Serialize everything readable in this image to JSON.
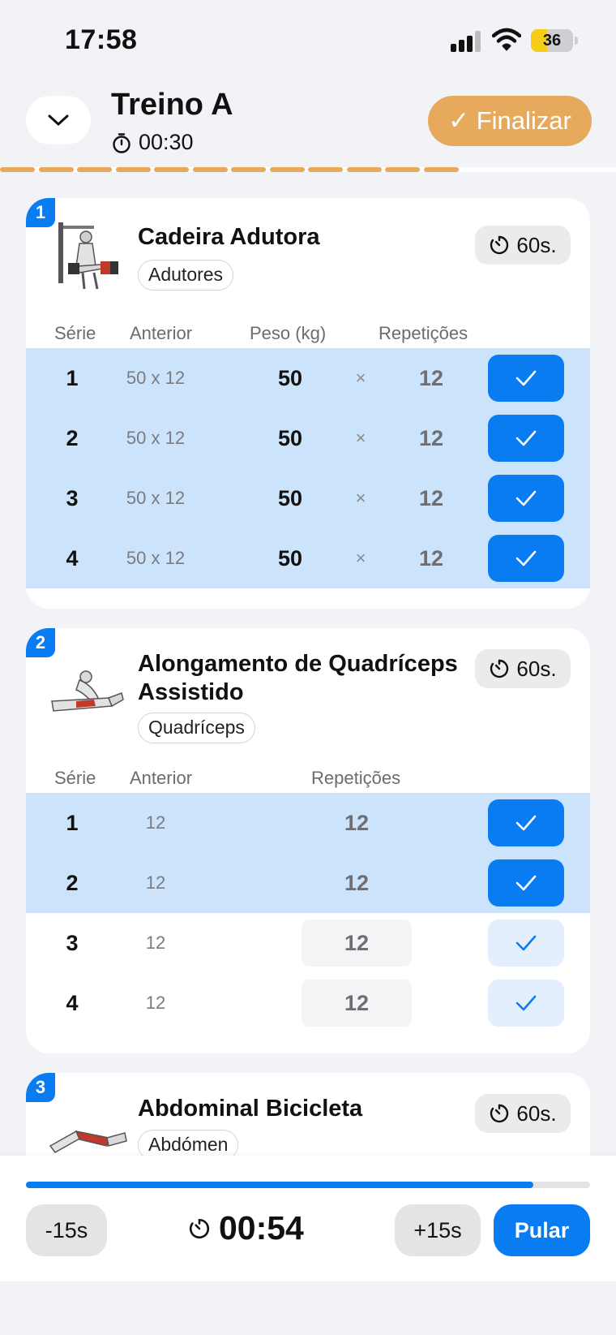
{
  "status_bar": {
    "time": "17:58",
    "battery": "36"
  },
  "header": {
    "title": "Treino A",
    "elapsed": "00:30",
    "finish_label": "✓ Finalizar",
    "collapse_icon": "chevron-down-icon",
    "progress_segments_done": 12
  },
  "exercises": [
    {
      "number": "1",
      "name": "Cadeira Adutora",
      "muscle": "Adutores",
      "rest": "60s.",
      "headers": {
        "serie": "Série",
        "anterior": "Anterior",
        "peso": "Peso (kg)",
        "reps": "Repetições"
      },
      "sets": [
        {
          "serie": "1",
          "anterior": "50 x 12",
          "peso": "50",
          "x": "×",
          "reps": "12",
          "done": true
        },
        {
          "serie": "2",
          "anterior": "50 x 12",
          "peso": "50",
          "x": "×",
          "reps": "12",
          "done": true
        },
        {
          "serie": "3",
          "anterior": "50 x 12",
          "peso": "50",
          "x": "×",
          "reps": "12",
          "done": true
        },
        {
          "serie": "4",
          "anterior": "50 x 12",
          "peso": "50",
          "x": "×",
          "reps": "12",
          "done": true
        }
      ]
    },
    {
      "number": "2",
      "name_line1": "Alongamento de Quadríceps",
      "name_line2": "Assistido",
      "muscle": "Quadríceps",
      "rest": "60s.",
      "headers": {
        "serie": "Série",
        "anterior": "Anterior",
        "reps": "Repetições"
      },
      "sets": [
        {
          "serie": "1",
          "anterior": "12",
          "reps": "12",
          "done": true
        },
        {
          "serie": "2",
          "anterior": "12",
          "reps": "12",
          "done": true
        },
        {
          "serie": "3",
          "anterior": "12",
          "reps": "12",
          "done": false
        },
        {
          "serie": "4",
          "anterior": "12",
          "reps": "12",
          "done": false
        }
      ]
    },
    {
      "number": "3",
      "name": "Abdominal Bicicleta",
      "muscle": "Abdómen",
      "rest": "60s."
    }
  ],
  "rest_timer": {
    "minus_label": "-15s",
    "plus_label": "+15s",
    "time": "00:54",
    "skip_label": "Pular",
    "progress": 0.9
  },
  "colors": {
    "accent": "#0a7cf2",
    "finish": "#e7aa5c",
    "done_row": "#cbe3fb"
  }
}
